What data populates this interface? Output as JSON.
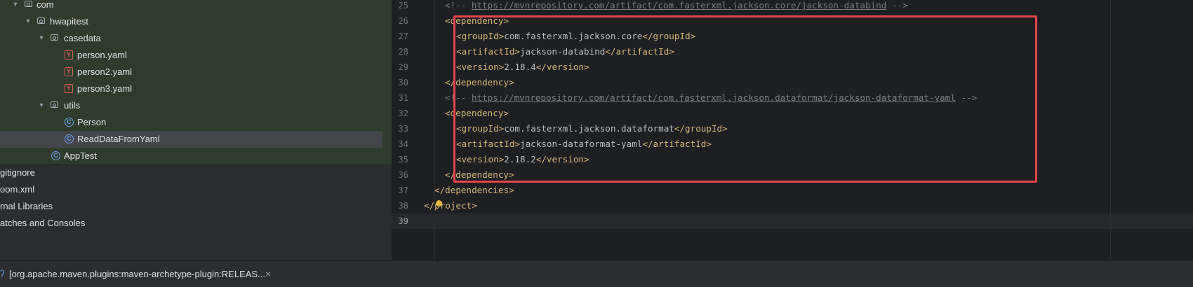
{
  "tree": {
    "items": [
      {
        "label": "com",
        "kind": "folder",
        "expanded": true
      },
      {
        "label": "hwapitest",
        "kind": "folder",
        "expanded": true
      },
      {
        "label": "casedata",
        "kind": "folder",
        "expanded": true
      },
      {
        "label": "person.yaml",
        "kind": "yaml"
      },
      {
        "label": "person2.yaml",
        "kind": "yaml"
      },
      {
        "label": "person3.yaml",
        "kind": "yaml"
      },
      {
        "label": "utils",
        "kind": "folder",
        "expanded": true
      },
      {
        "label": "Person",
        "kind": "class"
      },
      {
        "label": "ReadDataFromYaml",
        "kind": "class",
        "selected": true
      },
      {
        "label": "AppTest",
        "kind": "class"
      },
      {
        "label": "gitignore",
        "kind": "file"
      },
      {
        "label": "oom.xml",
        "kind": "file"
      },
      {
        "label": "rnal Libraries",
        "kind": "file"
      },
      {
        "label": "atches and Consoles",
        "kind": "file"
      }
    ]
  },
  "editor": {
    "lines": [
      {
        "num": "25",
        "parts": [
          [
            "cmt",
            "<!-- "
          ],
          [
            "url",
            "https://mvnrepository.com/artifact/com.fasterxml.jackson.core/jackson-databind"
          ],
          [
            "cmt",
            " -->"
          ]
        ]
      },
      {
        "num": "26",
        "parts": [
          [
            "tag",
            "<dependency>"
          ]
        ]
      },
      {
        "num": "27",
        "parts": [
          [
            "tag",
            "<groupId>"
          ],
          [
            "txt",
            "com.fasterxml.jackson.core"
          ],
          [
            "tag",
            "</groupId>"
          ]
        ]
      },
      {
        "num": "28",
        "parts": [
          [
            "tag",
            "<artifactId>"
          ],
          [
            "txt",
            "jackson-databind"
          ],
          [
            "tag",
            "</artifactId>"
          ]
        ]
      },
      {
        "num": "29",
        "parts": [
          [
            "tag",
            "<version>"
          ],
          [
            "txt",
            "2.18.4"
          ],
          [
            "tag",
            "</version>"
          ]
        ]
      },
      {
        "num": "30",
        "parts": [
          [
            "tag",
            "</dependency>"
          ]
        ]
      },
      {
        "num": "31",
        "parts": [
          [
            "cmt",
            "<!-- "
          ],
          [
            "url",
            "https://mvnrepository.com/artifact/com.fasterxml.jackson.dataformat/jackson-dataformat-yaml"
          ],
          [
            "cmt",
            " -->"
          ]
        ]
      },
      {
        "num": "32",
        "parts": [
          [
            "tag",
            "<dependency>"
          ]
        ]
      },
      {
        "num": "33",
        "parts": [
          [
            "tag",
            "<groupId>"
          ],
          [
            "txt",
            "com.fasterxml.jackson.dataformat"
          ],
          [
            "tag",
            "</groupId>"
          ]
        ]
      },
      {
        "num": "34",
        "parts": [
          [
            "tag",
            "<artifactId>"
          ],
          [
            "txt",
            "jackson-dataformat-yaml"
          ],
          [
            "tag",
            "</artifactId>"
          ]
        ]
      },
      {
        "num": "35",
        "parts": [
          [
            "tag",
            "<version>"
          ],
          [
            "txt",
            "2.18.2"
          ],
          [
            "tag",
            "</version>"
          ]
        ]
      },
      {
        "num": "36",
        "parts": [
          [
            "tag",
            "</dependency>"
          ]
        ]
      },
      {
        "num": "37",
        "parts": [
          [
            "tag",
            "</dependencies>"
          ]
        ]
      },
      {
        "num": "38",
        "parts": [
          [
            "tag",
            "<"
          ],
          [
            "tag",
            "/project>"
          ]
        ]
      },
      {
        "num": "39",
        "parts": []
      }
    ],
    "current_line": "39"
  },
  "bottom": {
    "run_tab_label": "[org.apache.maven.plugins:maven-archetype-plugin:RELEAS...",
    "close_glyph": "×"
  },
  "colors": {
    "highlight_border": "#e5444d",
    "tag": "#d5b778",
    "comment": "#7a7e85"
  }
}
